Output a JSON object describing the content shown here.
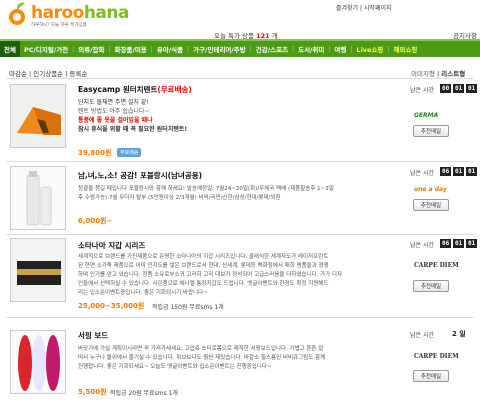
{
  "header": {
    "logo_text_a": "haroo",
    "logo_text_b": "hana",
    "tagline": "하루하나! 오늘 하루 특가상품",
    "top_links": "즐겨찾기 | 시작페이지",
    "daily_prefix": "오늘 특가 상품",
    "daily_count": "121",
    "daily_suffix": "개",
    "notice": "공지사항"
  },
  "nav": {
    "home": "전체",
    "items": [
      "PC/디지털/가전",
      "의류/잡화",
      "화장품/미용",
      "유아/식품",
      "가구/인테리어/주방",
      "건강/스포츠",
      "도서/취미",
      "여행",
      "Live쇼핑",
      "해외쇼핑"
    ]
  },
  "filters": {
    "text": "마감순 | 인기상품순 | 등록순",
    "view_image": "이미지형",
    "view_list": "리스트형"
  },
  "items": [
    {
      "title": "Easycamp 원터치텐트",
      "title_red": "(무료배송)",
      "desc": [
        "단지도 돌체면 주면 설치 끝!",
        "텐트 방법도 아주 쉽습니다~",
        "통풍에 좋 옷을 걸어입을 때나",
        "잠시 휴식을 위할 때 꼭 필요한 원터치텐트!"
      ],
      "price": "39,800원",
      "badge": "무료배송",
      "timer_label": "남은 시간",
      "timer": [
        "00",
        "01",
        "01"
      ],
      "brand": "GERMA",
      "button": "추천메일"
    },
    {
      "title": "남,녀,노,소! 공감! 포블랑시(남녀공용)",
      "desc": [
        "청결을 챙길 때입니다 포블랑시와 함께 하세요! 발송예정일: 7월24~20일(화)/우체국 택배 (제품할송후 1~3일",
        "후 수령가능) 7월 무더자 탈부 (5만원이상 2/3개월) 비씩/국민/신한/삼성/현대/롯데/외환"
      ],
      "price": "6,000원~",
      "timer_label": "남은 시간",
      "timer": [
        "06",
        "01",
        "01"
      ],
      "brand": "one a day",
      "button": "추천메일"
    },
    {
      "title": "소타나아 지갑 시리즈",
      "desc": [
        "세계적으로 브랜드를 가진제품으로 유명한 소타나아의 지갑 시리즈입니다. 클래식한 세계자도가 레이저프린트",
        "된 현연 소가죽 제품으로 이미 인지도를 쌓은 브랜드로서 현대, 신세계, 롯데등 백화점에서 매회 명품들과 경쟁",
        "하며 인기를 얻고 있습니다. 정품 소유로부소귀 고리하 고리 대보가 정석되어 고급스러움을 더하였습니다. 가가 디자",
        "인들에서 선택하실 수 있습니다. 사은품으로 에나멜 통장지갑도 드립니다. 엣글이벤트와 한정도 확정 지원해드",
        "리는 입소문이벤트중입니다. 좋은 기회되시기 바랍니다~"
      ],
      "price": "25,000~35,000원",
      "points": "적립금 150원  무료sms 1개",
      "timer_label": "남은 시간",
      "timer": [
        "06",
        "01",
        "01"
      ],
      "brand": "CARPE DIEM",
      "button": "추천메일"
    },
    {
      "title": "서핑 보드",
      "desc": [
        "바닷가에 가실 계획이시라면 꼭 가져가세세요, 고압축 스티로폼으로 제작한 서핑보드입니다. 가볍고 튼튼 잘",
        "떠서 누구나 물위에서 즐기실 수 있습니다. 튀브보다도 훨씬 재밌습니다. 바깥소 힐스름인 비비큐그림도 함께",
        "진행합니다. 좋은 기회되세요~ 오늘도 엣글이벤트와 입소문이벤트는 진행중입니다~"
      ],
      "price": "5,500원",
      "points": "적립금 20원  무료sms 1개",
      "timer_label": "남은 시간",
      "timer_text": "2 일",
      "brand": "CARPE DIEM",
      "button": "추천메일"
    }
  ]
}
